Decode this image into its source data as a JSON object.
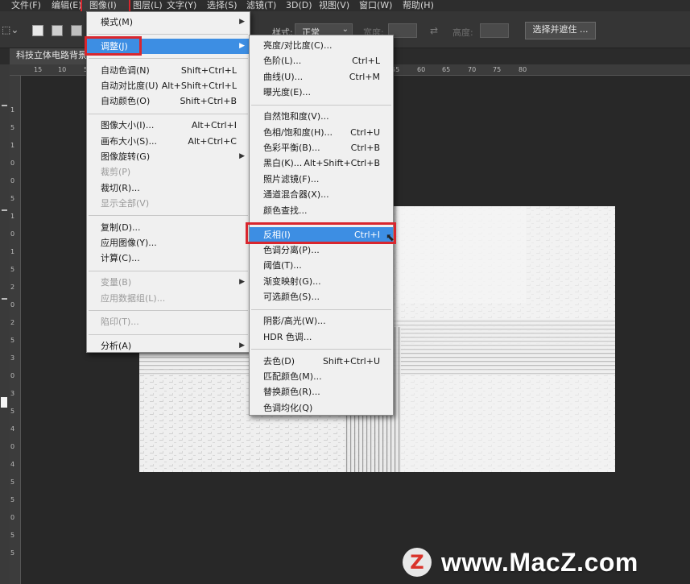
{
  "menubar": {
    "items": [
      "文件(F)",
      "编辑(E)",
      "图像(I)",
      "图层(L)",
      "文字(Y)",
      "选择(S)",
      "滤镜(T)",
      "3D(D)",
      "视图(V)",
      "窗口(W)",
      "帮助(H)"
    ]
  },
  "options": {
    "style_label": "样式:",
    "style_value": "正常",
    "width_label": "宽度:",
    "height_label": "高度:",
    "select_mask_button": "选择并遮住 ..."
  },
  "document": {
    "tab_title": "科技立体电路背景"
  },
  "ruler": {
    "h_ticks": [
      "15",
      "10",
      "5",
      "0",
      "5",
      "10",
      "15",
      "20",
      "25",
      "30",
      "35",
      "40",
      "45",
      "50",
      "55",
      "60",
      "65",
      "70",
      "75",
      "80"
    ],
    "v_ticks": [
      "1",
      "5",
      "1",
      "0",
      "0",
      "5",
      "1",
      "0",
      "1",
      "5",
      "2",
      "0",
      "2",
      "5",
      "3",
      "0",
      "3",
      "5",
      "4",
      "0",
      "4",
      "5",
      "5",
      "0",
      "5",
      "5"
    ]
  },
  "image_menu": {
    "items": [
      {
        "label": "模式(M)",
        "shortcut": "",
        "submenu": true,
        "disabled": false
      },
      {
        "sep": true
      },
      {
        "label": "调整(J)",
        "shortcut": "",
        "submenu": true,
        "disabled": false,
        "active": true
      },
      {
        "sep": true
      },
      {
        "label": "自动色调(N)",
        "shortcut": "Shift+Ctrl+L",
        "disabled": false
      },
      {
        "label": "自动对比度(U)",
        "shortcut": "Alt+Shift+Ctrl+L",
        "disabled": false
      },
      {
        "label": "自动颜色(O)",
        "shortcut": "Shift+Ctrl+B",
        "disabled": false
      },
      {
        "sep": true
      },
      {
        "label": "图像大小(I)...",
        "shortcut": "Alt+Ctrl+I",
        "disabled": false
      },
      {
        "label": "画布大小(S)...",
        "shortcut": "Alt+Ctrl+C",
        "disabled": false
      },
      {
        "label": "图像旋转(G)",
        "shortcut": "",
        "submenu": true,
        "disabled": false
      },
      {
        "label": "裁剪(P)",
        "shortcut": "",
        "disabled": true
      },
      {
        "label": "裁切(R)...",
        "shortcut": "",
        "disabled": false
      },
      {
        "label": "显示全部(V)",
        "shortcut": "",
        "disabled": true
      },
      {
        "sep": true
      },
      {
        "label": "复制(D)...",
        "shortcut": "",
        "disabled": false
      },
      {
        "label": "应用图像(Y)...",
        "shortcut": "",
        "disabled": false
      },
      {
        "label": "计算(C)...",
        "shortcut": "",
        "disabled": false
      },
      {
        "sep": true
      },
      {
        "label": "变量(B)",
        "shortcut": "",
        "submenu": true,
        "disabled": true
      },
      {
        "label": "应用数据组(L)...",
        "shortcut": "",
        "disabled": true
      },
      {
        "sep": true
      },
      {
        "label": "陷印(T)...",
        "shortcut": "",
        "disabled": true
      },
      {
        "sep": true
      },
      {
        "label": "分析(A)",
        "shortcut": "",
        "submenu": true,
        "disabled": false
      }
    ]
  },
  "adjust_menu": {
    "items": [
      {
        "label": "亮度/对比度(C)...",
        "shortcut": ""
      },
      {
        "label": "色阶(L)...",
        "shortcut": "Ctrl+L"
      },
      {
        "label": "曲线(U)...",
        "shortcut": "Ctrl+M"
      },
      {
        "label": "曝光度(E)...",
        "shortcut": ""
      },
      {
        "sep": true
      },
      {
        "label": "自然饱和度(V)...",
        "shortcut": ""
      },
      {
        "label": "色相/饱和度(H)...",
        "shortcut": "Ctrl+U"
      },
      {
        "label": "色彩平衡(B)...",
        "shortcut": "Ctrl+B"
      },
      {
        "label": "黑白(K)...",
        "shortcut": "Alt+Shift+Ctrl+B"
      },
      {
        "label": "照片滤镜(F)...",
        "shortcut": ""
      },
      {
        "label": "通道混合器(X)...",
        "shortcut": ""
      },
      {
        "label": "颜色查找...",
        "shortcut": ""
      },
      {
        "sep": true
      },
      {
        "label": "反相(I)",
        "shortcut": "Ctrl+I",
        "active": true
      },
      {
        "label": "色调分离(P)...",
        "shortcut": ""
      },
      {
        "label": "阈值(T)...",
        "shortcut": ""
      },
      {
        "label": "渐变映射(G)...",
        "shortcut": ""
      },
      {
        "label": "可选颜色(S)...",
        "shortcut": ""
      },
      {
        "sep": true
      },
      {
        "label": "阴影/高光(W)...",
        "shortcut": ""
      },
      {
        "label": "HDR 色调...",
        "shortcut": ""
      },
      {
        "sep": true
      },
      {
        "label": "去色(D)",
        "shortcut": "Shift+Ctrl+U"
      },
      {
        "label": "匹配颜色(M)...",
        "shortcut": ""
      },
      {
        "label": "替换颜色(R)...",
        "shortcut": ""
      },
      {
        "label": "色调均化(Q)",
        "shortcut": ""
      }
    ]
  },
  "watermark": {
    "logo": "Z",
    "text": "www.MacZ.com"
  },
  "colors": {
    "highlight_red": "#d9262e",
    "menu_active": "#3d8ee3",
    "menu_bg": "#f0f0f0",
    "app_bg": "#282828"
  }
}
